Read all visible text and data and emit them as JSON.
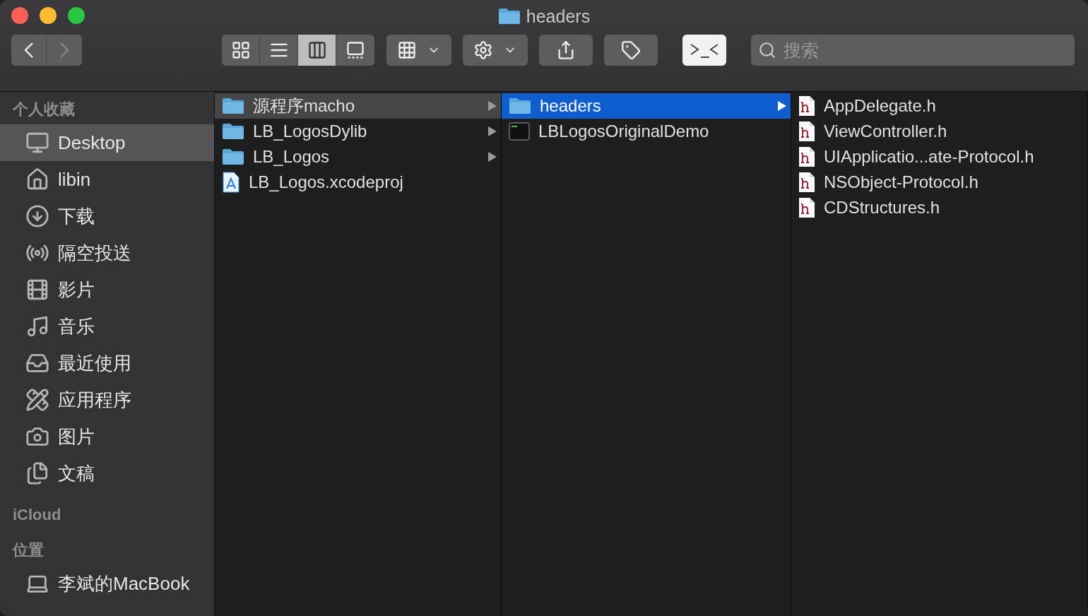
{
  "window": {
    "title": "headers"
  },
  "toolbar": {
    "back_enabled": true,
    "forward_enabled": false,
    "view_modes": [
      {
        "kind": "icons",
        "selected": false
      },
      {
        "kind": "list",
        "selected": false
      },
      {
        "kind": "columns",
        "selected": true
      },
      {
        "kind": "gallery",
        "selected": false
      }
    ],
    "search": {
      "placeholder": "搜索"
    }
  },
  "sidebar": {
    "sections": [
      {
        "title": "个人收藏",
        "items": [
          {
            "label": "Desktop",
            "kind": "desktop",
            "selected": true
          },
          {
            "label": "libin",
            "kind": "home",
            "selected": false
          },
          {
            "label": "下载",
            "kind": "downloads",
            "selected": false
          },
          {
            "label": "隔空投送",
            "kind": "airdrop",
            "selected": false
          },
          {
            "label": "影片",
            "kind": "movies",
            "selected": false
          },
          {
            "label": "音乐",
            "kind": "music",
            "selected": false
          },
          {
            "label": "最近使用",
            "kind": "recents",
            "selected": false
          },
          {
            "label": "应用程序",
            "kind": "applications",
            "selected": false
          },
          {
            "label": "图片",
            "kind": "pictures",
            "selected": false
          },
          {
            "label": "文稿",
            "kind": "documents",
            "selected": false
          }
        ]
      },
      {
        "title": "iCloud"
      },
      {
        "title": "位置",
        "items": [
          {
            "label": "李斌的MacBook",
            "kind": "computer",
            "selected": false
          }
        ]
      }
    ]
  },
  "columns": [
    {
      "focused": false,
      "items": [
        {
          "name": "源程序macho",
          "kind": "folder",
          "expandable": true,
          "selected": true
        },
        {
          "name": "LB_LogosDylib",
          "kind": "folder",
          "expandable": true,
          "selected": false
        },
        {
          "name": "LB_Logos",
          "kind": "folder",
          "expandable": true,
          "selected": false
        },
        {
          "name": "LB_Logos.xcodeproj",
          "kind": "project",
          "expandable": false,
          "selected": false
        }
      ]
    },
    {
      "focused": true,
      "items": [
        {
          "name": "headers",
          "kind": "folder",
          "expandable": true,
          "selected": true
        },
        {
          "name": "LBLogosOriginalDemo",
          "kind": "executable",
          "expandable": false,
          "selected": false
        }
      ]
    },
    {
      "items": [
        {
          "name": "AppDelegate.h",
          "kind": "header",
          "expandable": false,
          "selected": false
        },
        {
          "name": "ViewController.h",
          "kind": "header",
          "expandable": false,
          "selected": false
        },
        {
          "name": "UIApplicatio...ate-Protocol.h",
          "kind": "header",
          "expandable": false,
          "selected": false
        },
        {
          "name": "NSObject-Protocol.h",
          "kind": "header",
          "expandable": false,
          "selected": false
        },
        {
          "name": "CDStructures.h",
          "kind": "header",
          "expandable": false,
          "selected": false
        }
      ]
    }
  ]
}
